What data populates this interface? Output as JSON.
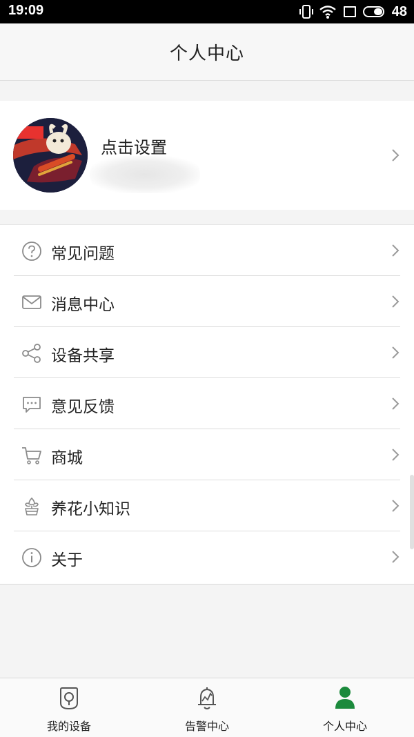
{
  "status_bar": {
    "time": "19:09",
    "battery": "48"
  },
  "header": {
    "title": "个人中心"
  },
  "profile": {
    "name": "点击设置",
    "avatar_icon": "avatar-image"
  },
  "menu": {
    "items": [
      {
        "label": "常见问题",
        "icon": "question-icon"
      },
      {
        "label": "消息中心",
        "icon": "mail-icon"
      },
      {
        "label": "设备共享",
        "icon": "share-icon"
      },
      {
        "label": "意见反馈",
        "icon": "feedback-icon"
      },
      {
        "label": "商城",
        "icon": "cart-icon"
      },
      {
        "label": "养花小知识",
        "icon": "flower-pot-icon"
      },
      {
        "label": "关于",
        "icon": "info-icon"
      }
    ]
  },
  "tabbar": {
    "tabs": [
      {
        "label": "我的设备",
        "icon": "device-icon",
        "active": false
      },
      {
        "label": "告警中心",
        "icon": "bell-icon",
        "active": false
      },
      {
        "label": "个人中心",
        "icon": "person-icon",
        "active": true
      }
    ]
  },
  "colors": {
    "accent": "#1b8a3c",
    "icon_gray": "#8a8a8a",
    "chevron": "#9a9a9a",
    "background": "#f4f4f4"
  }
}
